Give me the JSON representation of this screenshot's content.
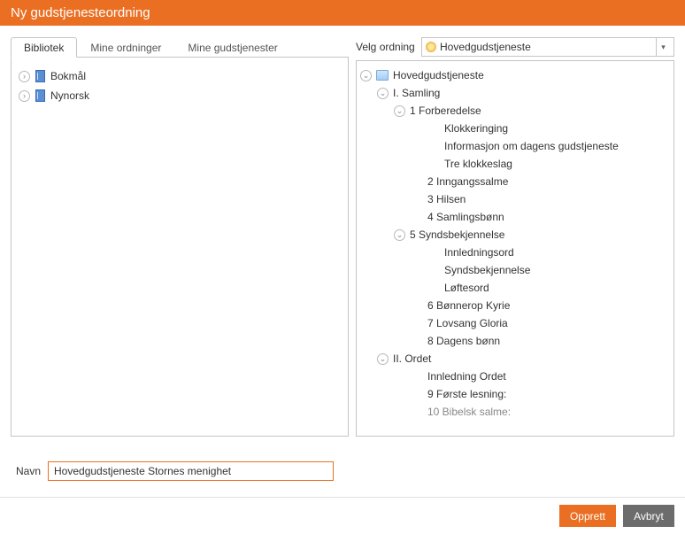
{
  "window": {
    "title": "Ny gudstjenesteordning"
  },
  "tabs": {
    "items": [
      {
        "label": "Bibliotek",
        "active": true
      },
      {
        "label": "Mine ordninger",
        "active": false
      },
      {
        "label": "Mine gudstjenester",
        "active": false
      }
    ]
  },
  "library": {
    "rows": [
      {
        "label": "Bokmål"
      },
      {
        "label": "Nynorsk"
      }
    ]
  },
  "velg": {
    "label": "Velg ordning",
    "selected": "Hovedgudstjeneste"
  },
  "tree": {
    "nodes": [
      {
        "indent": 0,
        "expander": true,
        "icon": "folder",
        "label": "Hovedgudstjeneste"
      },
      {
        "indent": 1,
        "expander": true,
        "label": "I. Samling"
      },
      {
        "indent": 2,
        "expander": true,
        "label": "1 Forberedelse"
      },
      {
        "indent": 4,
        "label": "Klokkeringing"
      },
      {
        "indent": 4,
        "label": "Informasjon om dagens gudstjeneste"
      },
      {
        "indent": 4,
        "label": "Tre klokkeslag"
      },
      {
        "indent": 3,
        "label": "2 Inngangssalme"
      },
      {
        "indent": 3,
        "label": "3 Hilsen"
      },
      {
        "indent": 3,
        "label": "4 Samlingsbønn"
      },
      {
        "indent": 2,
        "expander": true,
        "label": "5 Syndsbekjennelse"
      },
      {
        "indent": 4,
        "label": "Innledningsord"
      },
      {
        "indent": 4,
        "label": "Syndsbekjennelse"
      },
      {
        "indent": 4,
        "label": "Løftesord"
      },
      {
        "indent": 3,
        "label": "6 Bønnerop Kyrie"
      },
      {
        "indent": 3,
        "label": "7 Lovsang Gloria"
      },
      {
        "indent": 3,
        "label": "8 Dagens bønn"
      },
      {
        "indent": 1,
        "expander": true,
        "label": "II. Ordet"
      },
      {
        "indent": 3,
        "label": "Innledning Ordet"
      },
      {
        "indent": 3,
        "label": "9 Første lesning:"
      },
      {
        "indent": 3,
        "label": "10 Bibelsk salme:",
        "gray": true
      }
    ]
  },
  "navn": {
    "label": "Navn",
    "value": "Hovedgudstjeneste Stornes menighet"
  },
  "buttons": {
    "create": "Opprett",
    "cancel": "Avbryt"
  }
}
